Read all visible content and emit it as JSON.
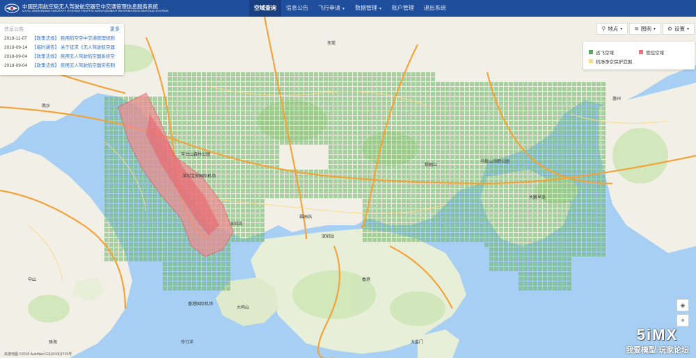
{
  "header": {
    "title_cn": "中国民用航空局无人驾驶航空器空中交通管理信息服务系统",
    "title_en": "CAAC UNMANNED AIRCRAFT SYSTEM TRAFFIC MANAGEMENT INFORMATION SERVICE SYSTEM",
    "nav": [
      {
        "label": "空域查询",
        "active": true,
        "has_caret": false
      },
      {
        "label": "信息公告",
        "active": false,
        "has_caret": false
      },
      {
        "label": "飞行申请",
        "active": false,
        "has_caret": true
      },
      {
        "label": "数据管理",
        "active": false,
        "has_caret": true
      },
      {
        "label": "账户管理",
        "active": false,
        "has_caret": false
      },
      {
        "label": "退出系统",
        "active": false,
        "has_caret": false
      }
    ]
  },
  "notice": {
    "title": "信息公告",
    "more": "更多",
    "items": [
      {
        "date": "2018-11-07",
        "tag": "【政策法规】",
        "title": "民用航空空中交通管理规则"
      },
      {
        "date": "2018-09-14",
        "tag": "【临时通告】",
        "title": "关于征求《无人驾驶航空器"
      },
      {
        "date": "2018-09-04",
        "tag": "【政策法规】",
        "title": "民用无人驾驶航空器系统空"
      },
      {
        "date": "2018-09-04",
        "tag": "【政策法规】",
        "title": "民用无人驾驶航空器实名制"
      }
    ]
  },
  "controls": {
    "locate": "地点",
    "layers": "图例",
    "settings": "设置"
  },
  "legend": {
    "items": [
      {
        "label": "适飞空域",
        "color": "#5aa65a"
      },
      {
        "label": "管控空域",
        "color": "#e8727a"
      },
      {
        "label": "机场净空保护范围",
        "color": "#f1dc8a"
      }
    ]
  },
  "map_labels": [
    "深圳宝安国际机场",
    "深圳站",
    "福田站",
    "深圳湾",
    "大鹏半岛",
    "马鞍山郊野公园",
    "羊台山森林公园",
    "梧桐山",
    "东莞",
    "惠州",
    "香港",
    "大屿山",
    "伶仃洋",
    "南沙",
    "中山",
    "珠海",
    "大金门",
    "香港国际机场"
  ],
  "watermark": {
    "big": "5iMX",
    "small": "我爱模型 玩家论坛"
  },
  "copyright": "高德地图 ©2018 AutoNavi GS(2018)1719号"
}
